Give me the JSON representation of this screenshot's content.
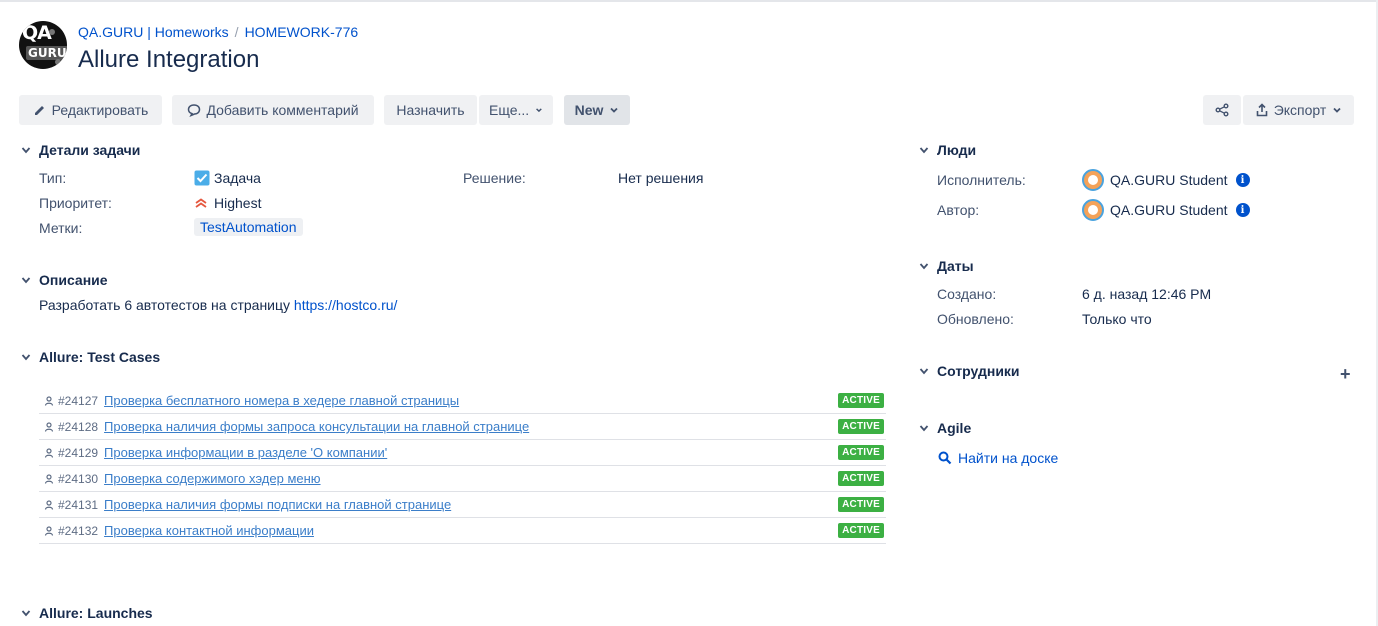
{
  "header": {
    "breadcrumb": [
      "QA.GURU | Homeworks",
      "HOMEWORK-776"
    ],
    "breadcrumb_sep": "/",
    "title": "Allure Integration",
    "logo_text_top": "QA",
    "logo_text_bottom": "GURU"
  },
  "toolbar": {
    "edit": "Редактировать",
    "comment": "Добавить комментарий",
    "assign": "Назначить",
    "more": "Еще...",
    "status": "New",
    "export": "Экспорт"
  },
  "details": {
    "heading": "Детали задачи",
    "type_label": "Тип:",
    "type_value": "Задача",
    "priority_label": "Приоритет:",
    "priority_value": "Highest",
    "labels_label": "Метки:",
    "labels_value": "TestAutomation",
    "resolution_label": "Решение:",
    "resolution_value": "Нет решения"
  },
  "description": {
    "heading": "Описание",
    "text": "Разработать 6 автотестов на страницу ",
    "link": "https://hostco.ru/"
  },
  "test_cases": {
    "heading": "Allure: Test Cases",
    "items": [
      {
        "id": "#24127",
        "name": "Проверка бесплатного номера в хедере главной страницы",
        "status": "ACTIVE"
      },
      {
        "id": "#24128",
        "name": "Проверка наличия формы запроса консультации на главной странице",
        "status": "ACTIVE"
      },
      {
        "id": "#24129",
        "name": "Проверка информации в разделе 'О компании'",
        "status": "ACTIVE"
      },
      {
        "id": "#24130",
        "name": "Проверка содержимого хэдер меню",
        "status": "ACTIVE"
      },
      {
        "id": "#24131",
        "name": "Проверка наличия формы подписки на главной странице",
        "status": "ACTIVE"
      },
      {
        "id": "#24132",
        "name": "Проверка контактной информации",
        "status": "ACTIVE"
      }
    ]
  },
  "launches": {
    "heading": "Allure: Launches"
  },
  "people": {
    "heading": "Люди",
    "assignee_label": "Исполнитель:",
    "assignee": "QA.GURU Student",
    "reporter_label": "Автор:",
    "reporter": "QA.GURU Student"
  },
  "dates": {
    "heading": "Даты",
    "created_label": "Создано:",
    "created": "6 д. назад 12:46 PM",
    "updated_label": "Обновлено:",
    "updated": "Только что"
  },
  "staff": {
    "heading": "Сотрудники",
    "add_icon": "+"
  },
  "agile": {
    "heading": "Agile",
    "find_on_board": "Найти на доске"
  },
  "colors": {
    "link": "#0052cc",
    "badge_active": "#3cb043",
    "priority": "#e5573e"
  }
}
